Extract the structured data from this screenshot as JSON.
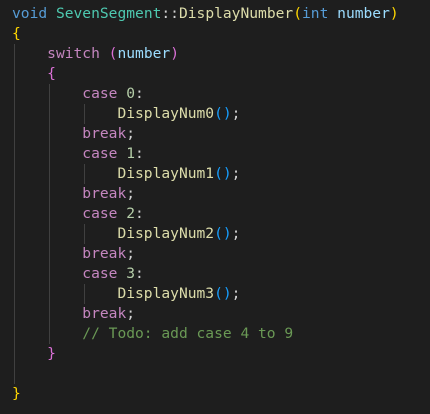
{
  "editor": {
    "background": "#1e1e1e",
    "lines": {
      "l1": {
        "kw_void": "void",
        "class_name": "SevenSegment",
        "scope": "::",
        "func": "DisplayNumber",
        "paren_open": "(",
        "kw_int": "int",
        "param": "number",
        "paren_close": ")"
      },
      "l2": {
        "brace": "{"
      },
      "l3": {
        "kw_switch": "switch",
        "paren_open": "(",
        "var": "number",
        "paren_close": ")"
      },
      "l4": {
        "brace": "{"
      },
      "l5": {
        "kw_case": "case",
        "num": "0",
        "colon": ":"
      },
      "l6": {
        "func": "DisplayNum0",
        "parens": "()",
        "semi": ";"
      },
      "l7": {
        "kw_break": "break",
        "semi": ";"
      },
      "l8": {
        "kw_case": "case",
        "num": "1",
        "colon": ":"
      },
      "l9": {
        "func": "DisplayNum1",
        "parens": "()",
        "semi": ";"
      },
      "l10": {
        "kw_break": "break",
        "semi": ";"
      },
      "l11": {
        "kw_case": "case",
        "num": "2",
        "colon": ":"
      },
      "l12": {
        "func": "DisplayNum2",
        "parens": "()",
        "semi": ";"
      },
      "l13": {
        "kw_break": "break",
        "semi": ";"
      },
      "l14": {
        "kw_case": "case",
        "num": "3",
        "colon": ":"
      },
      "l15": {
        "func": "DisplayNum3",
        "parens": "()",
        "semi": ";"
      },
      "l16": {
        "kw_break": "break",
        "semi": ";"
      },
      "l17": {
        "comment": "// Todo: add case 4 to 9"
      },
      "l18": {
        "brace": "}"
      },
      "l19": {
        "text": ""
      },
      "l20": {
        "brace": "}"
      }
    }
  }
}
